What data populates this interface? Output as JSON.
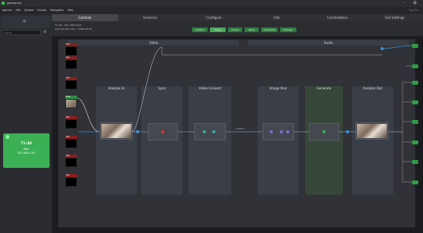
{
  "window": {
    "title": "gstreamer",
    "controls": [
      "–",
      "⧉"
    ]
  },
  "menu": {
    "items": [
      "gstcmd",
      "Edit",
      "System",
      "Chassis",
      "Navigation",
      "Help"
    ],
    "right": "Log Out"
  },
  "sidebar": {
    "search_placeholder": "Search",
    "tile": {
      "title": "T1-40",
      "line1": "Main",
      "line2": "192.168.0.101"
    }
  },
  "tabs": [
    {
      "label": "Controls",
      "active": true
    },
    {
      "label": "Universe",
      "active": false
    },
    {
      "label": "Configure",
      "active": false
    },
    {
      "label": "Info",
      "active": false
    },
    {
      "label": "Constellation",
      "active": false
    },
    {
      "label": "GUI Settings",
      "active": false
    }
  ],
  "device": {
    "line1": "T1-40 · 192.168.0.101",
    "line2": "Decoder/Encoder · 1080i/59.94"
  },
  "subtabs": [
    {
      "label": "System",
      "active": false
    },
    {
      "label": "Video",
      "active": true
    },
    {
      "label": "Frame",
      "active": false
    },
    {
      "label": "Store",
      "active": false
    },
    {
      "label": "Advanced",
      "active": false
    },
    {
      "label": "Preview",
      "active": false
    }
  ],
  "sections": {
    "video": "Video",
    "audio": "Audio"
  },
  "inputs": [
    {
      "label": "SDI",
      "color": "red"
    },
    {
      "label": "SDI",
      "color": "red"
    },
    {
      "label": "SDI",
      "color": "red"
    },
    {
      "label": "Main",
      "color": "green"
    },
    {
      "label": "SDI",
      "color": "red"
    },
    {
      "label": "SDI",
      "color": "red"
    },
    {
      "label": "SDI",
      "color": "red"
    },
    {
      "label": "SDI",
      "color": "red"
    }
  ],
  "columns": [
    {
      "label": "Analyze In"
    },
    {
      "label": "Sync"
    },
    {
      "label": "Video Convert"
    },
    {
      "label": "Image Proc"
    },
    {
      "label": "Generate"
    },
    {
      "label": "Analyze Out"
    }
  ],
  "connector_label": "1080i59",
  "colors": {
    "accent": "#3cb054",
    "input_red": "#8b1e1e",
    "input_green": "#2f8f45",
    "link_blue": "#3a8fd9"
  }
}
